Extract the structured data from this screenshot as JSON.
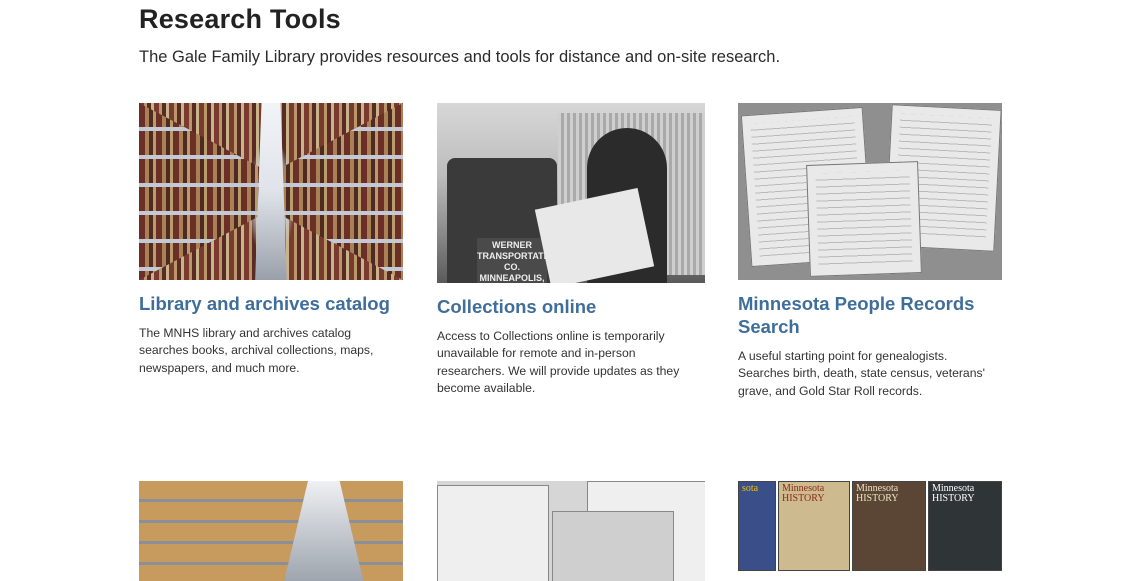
{
  "header": {
    "title": "Research Tools",
    "intro": "The Gale Family Library provides resources and tools for distance and on-site research."
  },
  "cards": [
    {
      "title": "Library and archives catalog",
      "description": "The MNHS library and archives catalog searches books, archival collections, maps, newspapers, and much more."
    },
    {
      "title": "Collections online",
      "description": "Access to Collections online is temporarily unavailable for remote and in-person researchers. We will provide updates as they become available."
    },
    {
      "title": "Minnesota People Records Search",
      "description": "A useful starting point for genealogists. Searches birth, death, state census, veterans' grave, and Gold Star Roll records."
    }
  ],
  "images": {
    "truck_sign": "WERNER TRANSPORTATION CO. MINNEAPOLIS, MINN.",
    "magazines": [
      "sota",
      "Minnesota HISTORY",
      "Minnesota HISTORY",
      "Minnesota HISTORY"
    ]
  },
  "colors": {
    "link": "#3f6e9a",
    "heading": "#222222",
    "text": "#333333"
  }
}
